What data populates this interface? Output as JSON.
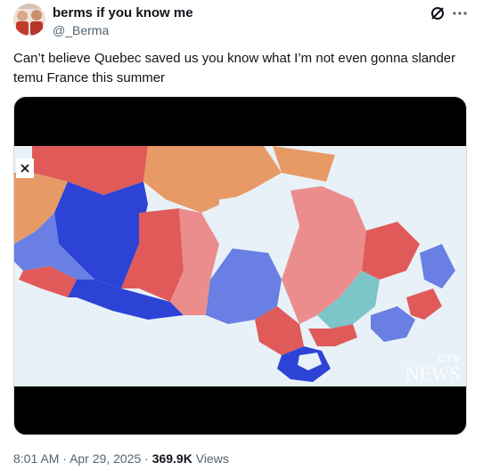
{
  "author": {
    "display_name": "berms if you know me",
    "handle": "@_Berma"
  },
  "tweet": {
    "text": "Can’t believe Quebec saved us you know what I’m not even gonna slander temu France this summer"
  },
  "media": {
    "close_icon": "close-icon",
    "watermark_top": "CTV",
    "watermark_bottom": "NEWS",
    "colors": {
      "conservative_blue": "#2d43d6",
      "light_blue": "#6a7fe3",
      "liberal_red": "#e05a5a",
      "light_red": "#ec8d8d",
      "ndp_orange": "#e79a66",
      "bloc_teal": "#7cc5c8",
      "water": "#e8f1f7"
    }
  },
  "meta": {
    "time": "8:01 AM",
    "separator": "·",
    "date": "Apr 29, 2025",
    "views_count": "369.9K",
    "views_label": "Views"
  },
  "icons": {
    "grok": "grok-icon",
    "more": "more-icon"
  }
}
